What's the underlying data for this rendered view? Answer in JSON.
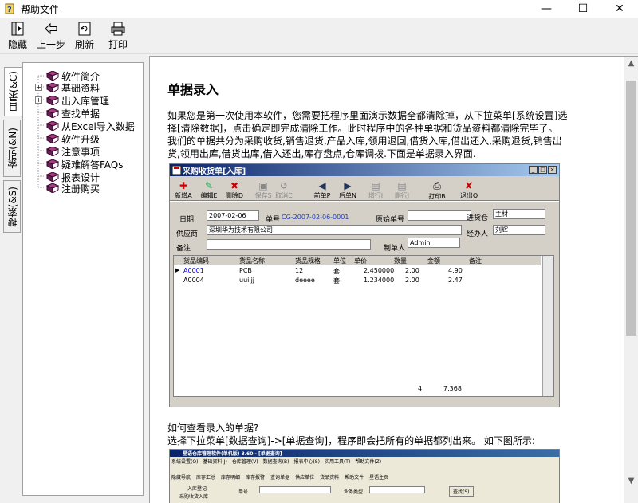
{
  "window": {
    "title": "帮助文件",
    "minimize": "—",
    "maximize": "☐",
    "close": "✕"
  },
  "toolbar": [
    {
      "label": "隐藏",
      "icon": "hide-icon"
    },
    {
      "label": "上一步",
      "icon": "back-icon"
    },
    {
      "label": "刷新",
      "icon": "refresh-icon"
    },
    {
      "label": "打印",
      "icon": "print-icon"
    }
  ],
  "tabs": [
    "目录(&C)",
    "索引(&N)",
    "搜索(&S)"
  ],
  "tree": [
    {
      "label": "软件简介",
      "expandable": false
    },
    {
      "label": "基础资料",
      "expandable": true
    },
    {
      "label": "出入库管理",
      "expandable": true
    },
    {
      "label": "查找单据",
      "expandable": false
    },
    {
      "label": "从Excel导入数据",
      "expandable": false
    },
    {
      "label": "软件升级",
      "expandable": false
    },
    {
      "label": "注意事项",
      "expandable": false
    },
    {
      "label": "疑难解答FAQs",
      "expandable": false
    },
    {
      "label": "报表设计",
      "expandable": false
    },
    {
      "label": "注册购买",
      "expandable": false
    }
  ],
  "doc": {
    "heading": "单据录入",
    "p1": [
      "如果您是第一次使用本软件，您需要把程序里面演示数据全都清除掉，从下拉菜单[系统设置]选",
      "择[清除数据]，点击确定即完成清除工作。此时程序中的各种单据和货品资料都清除完毕了。",
      "我们的单据共分为采购收货,销售退货,产品入库,领用退回,借货入库,借出还入,采购退货,销售出",
      "货,领用出库,借货出库,借入还出,库存盘点,仓库调拨.下面是单据录入界面."
    ],
    "p2": [
      "如何查看录入的单据?",
      "选择下拉菜单[数据查询]->[单据查询]，程序即会把所有的单据都列出来。  如下图所示:"
    ]
  },
  "shot1": {
    "title": "采购收货单[入库]",
    "buttons": [
      "新增A",
      "编辑E",
      "删除D",
      "保存S",
      "取消C",
      "前单P",
      "后单N",
      "增行I",
      "删行J",
      "打印B",
      "退出Q"
    ],
    "date_label": "日期",
    "date": "2007-02-06",
    "no_label": "单号",
    "no": "CG-2007-02-06-0001",
    "orig_label": "原始单号",
    "warehouse_label": "进货仓",
    "warehouse": "主材",
    "supplier_label": "供应商",
    "supplier": "深圳华为技术有限公司",
    "handler_label": "经办人",
    "handler": "刘辉",
    "remark_label": "备注",
    "maker_label": "制单人",
    "maker": "Admin",
    "columns": [
      "货品编码",
      "货品名称",
      "货品规格",
      "单位",
      "单价",
      "数量",
      "金额",
      "备注"
    ],
    "rows": [
      [
        "A0001",
        "PCB",
        "12",
        "套",
        "2.450000",
        "2.00",
        "4.90",
        ""
      ],
      [
        "A0004",
        "uuiijj",
        "deeee",
        "套",
        "1.234000",
        "2.00",
        "2.47",
        ""
      ]
    ],
    "total_qty": "4",
    "total_amount": "7.368"
  },
  "shot2": {
    "title": "星语仓库管理软件(单机版) 3.60 - [单据查询]",
    "menu": [
      "系统设置(Q)",
      "基础资料(J)",
      "仓库管理(V)",
      "数据查询(B)",
      "报表中心(S)",
      "实用工具(T)",
      "帮助文件(Z)"
    ],
    "tools": [
      "隐藏导航",
      "库存汇总",
      "库存明细",
      "库存报警",
      "查询单据",
      "供应单位",
      "货品资料",
      "帮助文件",
      "星语主页"
    ],
    "nav_label": "入库登记",
    "nav_item": "采购收货入库",
    "no_label": "单号",
    "type_label": "业务类型",
    "search_label": "查找(S)"
  }
}
